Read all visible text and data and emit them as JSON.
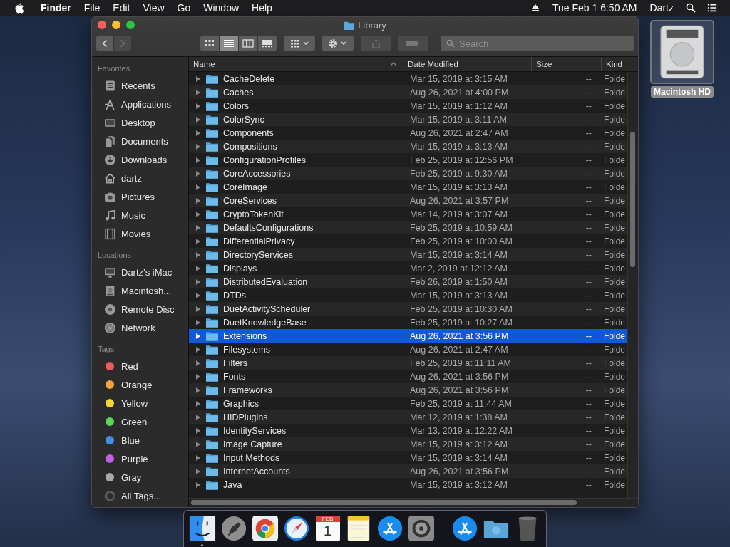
{
  "menu_bar": {
    "app_name": "Finder",
    "menus": [
      "File",
      "Edit",
      "View",
      "Go",
      "Window",
      "Help"
    ],
    "clock": "Tue Feb 1  6:50 AM",
    "user": "Dartz"
  },
  "desktop": {
    "icons": [
      {
        "label": "Macintosh HD"
      }
    ]
  },
  "window": {
    "title": "Library",
    "toolbar": {
      "back_disabled": false,
      "forward_disabled": true,
      "view_modes": [
        {
          "kind": "icons",
          "selected": false
        },
        {
          "kind": "list",
          "selected": true
        },
        {
          "kind": "columns",
          "selected": false
        },
        {
          "kind": "gallery",
          "selected": false
        }
      ],
      "search": {
        "placeholder": "Search"
      }
    },
    "sidebar": {
      "sections": [
        {
          "title": "Favorites",
          "items": [
            {
              "label": "Recents",
              "kind": "recents",
              "selected": false
            },
            {
              "label": "Applications",
              "kind": "applications",
              "selected": false
            },
            {
              "label": "Desktop",
              "kind": "desktop",
              "selected": false
            },
            {
              "label": "Documents",
              "kind": "documents",
              "selected": false
            },
            {
              "label": "Downloads",
              "kind": "downloads",
              "selected": false
            },
            {
              "label": "dartz",
              "kind": "home",
              "selected": false
            },
            {
              "label": "Pictures",
              "kind": "pictures",
              "selected": false
            },
            {
              "label": "Music",
              "kind": "music",
              "selected": false
            },
            {
              "label": "Movies",
              "kind": "movies",
              "selected": false
            }
          ]
        },
        {
          "title": "Locations",
          "items": [
            {
              "label": "Dartz’s iMac",
              "kind": "computer",
              "selected": false
            },
            {
              "label": "Macintosh...",
              "kind": "disk",
              "selected": false
            },
            {
              "label": "Remote Disc",
              "kind": "disc",
              "selected": false
            },
            {
              "label": "Network",
              "kind": "network",
              "selected": false
            }
          ]
        },
        {
          "title": "Tags",
          "items": [
            {
              "label": "Red",
              "kind": "tag",
              "color": "#ec5a5e",
              "selected": false
            },
            {
              "label": "Orange",
              "kind": "tag",
              "color": "#f4a23a",
              "selected": false
            },
            {
              "label": "Yellow",
              "kind": "tag",
              "color": "#f4d63a",
              "selected": false
            },
            {
              "label": "Green",
              "kind": "tag",
              "color": "#5ad65a",
              "selected": false
            },
            {
              "label": "Blue",
              "kind": "tag",
              "color": "#3d8ff0",
              "selected": false
            },
            {
              "label": "Purple",
              "kind": "tag",
              "color": "#c25ee8",
              "selected": false
            },
            {
              "label": "Gray",
              "kind": "tag",
              "color": "#a8a8a8",
              "selected": false
            },
            {
              "label": "All Tags...",
              "kind": "all_tags",
              "selected": false
            }
          ]
        }
      ]
    },
    "table": {
      "columns": [
        {
          "label": "Name",
          "sorted": true
        },
        {
          "label": "Date Modified",
          "sorted": false
        },
        {
          "label": "Size",
          "sorted": false
        },
        {
          "label": "Kind",
          "sorted": false
        }
      ],
      "rows": [
        {
          "name": "CacheDelete",
          "date": "Mar 15, 2019 at 3:15 AM",
          "size": "--",
          "kind": "Folde",
          "selected": false
        },
        {
          "name": "Caches",
          "date": "Aug 26, 2021 at 4:00 PM",
          "size": "--",
          "kind": "Folde",
          "selected": false
        },
        {
          "name": "Colors",
          "date": "Mar 15, 2019 at 1:12 AM",
          "size": "--",
          "kind": "Folde",
          "selected": false
        },
        {
          "name": "ColorSync",
          "date": "Mar 15, 2019 at 3:11 AM",
          "size": "--",
          "kind": "Folde",
          "selected": false
        },
        {
          "name": "Components",
          "date": "Aug 26, 2021 at 2:47 AM",
          "size": "--",
          "kind": "Folde",
          "selected": false
        },
        {
          "name": "Compositions",
          "date": "Mar 15, 2019 at 3:13 AM",
          "size": "--",
          "kind": "Folde",
          "selected": false
        },
        {
          "name": "ConfigurationProfiles",
          "date": "Feb 25, 2019 at 12:56 PM",
          "size": "--",
          "kind": "Folde",
          "selected": false
        },
        {
          "name": "CoreAccessories",
          "date": "Feb 25, 2019 at 9:30 AM",
          "size": "--",
          "kind": "Folde",
          "selected": false
        },
        {
          "name": "CoreImage",
          "date": "Mar 15, 2019 at 3:13 AM",
          "size": "--",
          "kind": "Folde",
          "selected": false
        },
        {
          "name": "CoreServices",
          "date": "Aug 26, 2021 at 3:57 PM",
          "size": "--",
          "kind": "Folde",
          "selected": false
        },
        {
          "name": "CryptoTokenKit",
          "date": "Mar 14, 2019 at 3:07 AM",
          "size": "--",
          "kind": "Folde",
          "selected": false
        },
        {
          "name": "DefaultsConfigurations",
          "date": "Feb 25, 2019 at 10:59 AM",
          "size": "--",
          "kind": "Folde",
          "selected": false
        },
        {
          "name": "DifferentialPrivacy",
          "date": "Feb 25, 2019 at 10:00 AM",
          "size": "--",
          "kind": "Folde",
          "selected": false
        },
        {
          "name": "DirectoryServices",
          "date": "Mar 15, 2019 at 3:14 AM",
          "size": "--",
          "kind": "Folde",
          "selected": false
        },
        {
          "name": "Displays",
          "date": "Mar 2, 2019 at 12:12 AM",
          "size": "--",
          "kind": "Folde",
          "selected": false
        },
        {
          "name": "DistributedEvaluation",
          "date": "Feb 26, 2019 at 1:50 AM",
          "size": "--",
          "kind": "Folde",
          "selected": false
        },
        {
          "name": "DTDs",
          "date": "Mar 15, 2019 at 3:13 AM",
          "size": "--",
          "kind": "Folde",
          "selected": false
        },
        {
          "name": "DuetActivityScheduler",
          "date": "Feb 25, 2019 at 10:30 AM",
          "size": "--",
          "kind": "Folde",
          "selected": false
        },
        {
          "name": "DuetKnowledgeBase",
          "date": "Feb 25, 2019 at 10:27 AM",
          "size": "--",
          "kind": "Folde",
          "selected": false
        },
        {
          "name": "Extensions",
          "date": "Aug 26, 2021 at 3:56 PM",
          "size": "--",
          "kind": "Folde",
          "selected": true
        },
        {
          "name": "Filesystems",
          "date": "Aug 26, 2021 at 2:47 AM",
          "size": "--",
          "kind": "Folde",
          "selected": false
        },
        {
          "name": "Filters",
          "date": "Feb 25, 2019 at 11:11 AM",
          "size": "--",
          "kind": "Folde",
          "selected": false
        },
        {
          "name": "Fonts",
          "date": "Aug 26, 2021 at 3:56 PM",
          "size": "--",
          "kind": "Folde",
          "selected": false
        },
        {
          "name": "Frameworks",
          "date": "Aug 26, 2021 at 3:56 PM",
          "size": "--",
          "kind": "Folde",
          "selected": false
        },
        {
          "name": "Graphics",
          "date": "Feb 25, 2019 at 11:44 AM",
          "size": "--",
          "kind": "Folde",
          "selected": false
        },
        {
          "name": "HIDPlugins",
          "date": "Mar 12, 2019 at 1:38 AM",
          "size": "--",
          "kind": "Folde",
          "selected": false
        },
        {
          "name": "IdentityServices",
          "date": "Mar 13, 2019 at 12:22 AM",
          "size": "--",
          "kind": "Folde",
          "selected": false
        },
        {
          "name": "Image Capture",
          "date": "Mar 15, 2019 at 3:12 AM",
          "size": "--",
          "kind": "Folde",
          "selected": false
        },
        {
          "name": "Input Methods",
          "date": "Mar 15, 2019 at 3:14 AM",
          "size": "--",
          "kind": "Folde",
          "selected": false
        },
        {
          "name": "InternetAccounts",
          "date": "Aug 26, 2021 at 3:56 PM",
          "size": "--",
          "kind": "Folde",
          "selected": false
        },
        {
          "name": "Java",
          "date": "Mar 15, 2019 at 3:12 AM",
          "size": "--",
          "kind": "Folde",
          "selected": false
        }
      ]
    }
  },
  "dock": {
    "items": [
      {
        "kind": "finder",
        "running": true
      },
      {
        "kind": "launchpad"
      },
      {
        "kind": "chrome"
      },
      {
        "kind": "safari"
      },
      {
        "kind": "calendar",
        "month": "FEB",
        "day": "1"
      },
      {
        "kind": "notes"
      },
      {
        "kind": "appstore"
      },
      {
        "kind": "settings"
      },
      {
        "kind": "separator"
      },
      {
        "kind": "appstore"
      },
      {
        "kind": "downloads"
      },
      {
        "kind": "trash"
      }
    ]
  }
}
